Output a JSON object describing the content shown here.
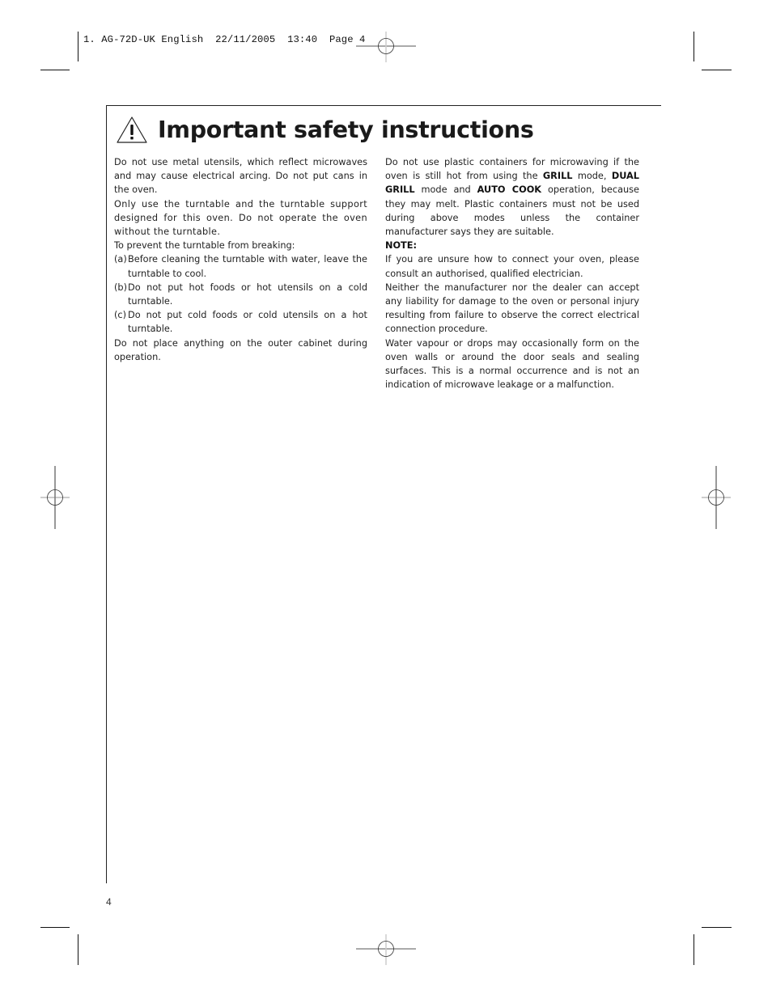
{
  "slug": {
    "text": "1. AG-72D-UK English  22/11/2005  13:40  Page 4"
  },
  "header": {
    "icon": "warning-triangle-icon",
    "title": "Important safety instructions"
  },
  "left_column": {
    "p1": "Do not use metal utensils, which reflect microwaves and may cause electrical arcing. Do not put cans in the oven.",
    "p2": "Only use the turntable and the turntable support designed for this oven. Do not operate the oven without the turntable.",
    "p3": "To prevent the turntable from breaking:",
    "items": [
      {
        "label": "(a)",
        "text": "Before cleaning the turntable with water, leave the turntable to cool."
      },
      {
        "label": "(b)",
        "text": "Do not put hot foods or hot utensils on a cold turntable."
      },
      {
        "label": "(c)",
        "text": "Do not put cold foods or cold utensils on a hot turntable."
      }
    ],
    "p4": "Do not place anything on the outer cabinet during operation."
  },
  "right_column": {
    "p1_a": "Do not use plastic containers for microwaving if the oven is still hot from using the ",
    "p1_b1": "GRILL",
    "p1_c": " mode, ",
    "p1_b2": "DUAL GRILL",
    "p1_d": " mode and ",
    "p1_b3": "AUTO COOK",
    "p1_e": " operation, because they may melt. Plastic containers must not be used during above modes unless the container manufacturer says they are suitable.",
    "note_label": "NOTE:",
    "p2": "If you are unsure how to connect your oven, please consult an authorised, qualified electrician.",
    "p3": "Neither the manufacturer nor the dealer can accept any liability for damage to the oven or personal injury resulting from failure to observe the correct electrical connection procedure.",
    "p4": "Water vapour or drops may occasionally form on the oven walls or around the door seals and sealing surfaces. This is a normal occurrence and is not an indication of microwave leakage or a malfunction."
  },
  "footer": {
    "page_number": "4"
  }
}
